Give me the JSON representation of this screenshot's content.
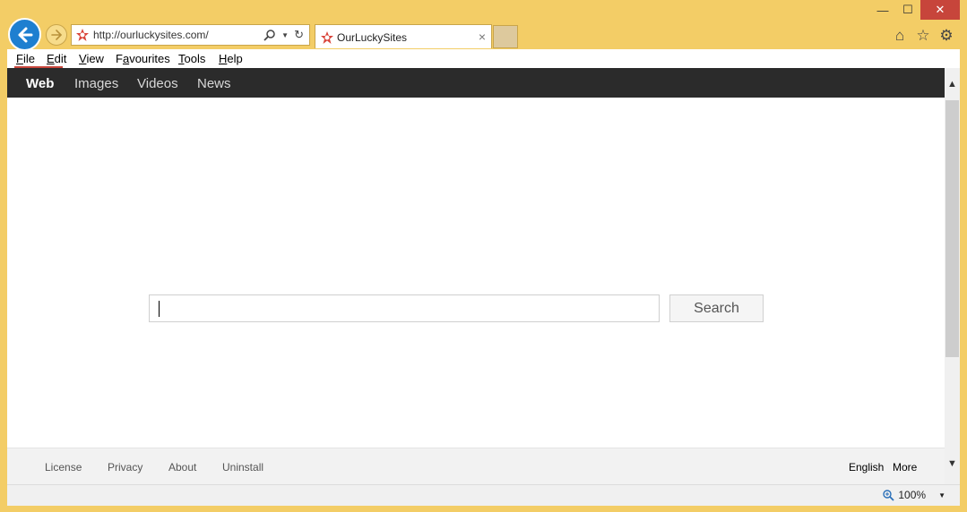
{
  "address": {
    "url": "http://ourluckysites.com/"
  },
  "tab": {
    "title": "OurLuckySites",
    "close": "×"
  },
  "window": {
    "minimize": "—",
    "maximize": "☐",
    "close": "✕"
  },
  "tools": {
    "home": "⌂",
    "favorites": "☆",
    "settings": "⚙"
  },
  "menu": {
    "items": [
      {
        "label": "File",
        "u": "F",
        "rest": "ile"
      },
      {
        "label": "Edit",
        "u": "E",
        "rest": "dit"
      },
      {
        "label": "View",
        "u": "V",
        "rest": "iew"
      },
      {
        "label": "Favourites",
        "pre": "F",
        "u": "a",
        "rest": "vourites"
      },
      {
        "label": "Tools",
        "u": "T",
        "rest": "ools"
      },
      {
        "label": "Help",
        "u": "H",
        "rest": "elp"
      }
    ]
  },
  "nav": {
    "items": [
      "Web",
      "Images",
      "Videos",
      "News"
    ],
    "active": "Web"
  },
  "search": {
    "button_label": "Search",
    "value": ""
  },
  "footer": {
    "links": [
      "License",
      "Privacy",
      "About",
      "Uninstall"
    ],
    "language": "English",
    "more": "More"
  },
  "status": {
    "zoom": "100%"
  },
  "colors": {
    "accent": "#1e7fd0",
    "frame": "#f3cd66",
    "navbar": "#2b2b2b",
    "close": "#c7453b"
  }
}
